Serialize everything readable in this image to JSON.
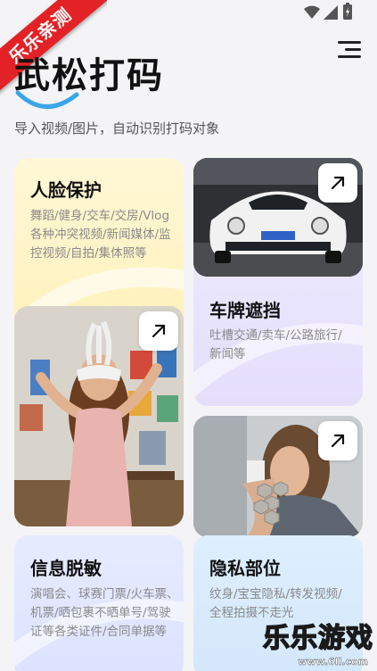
{
  "watermark_top": "乐乐亲测",
  "watermark_bottom": {
    "logo": "乐乐游戏",
    "url": "www.6ll.com"
  },
  "header": {
    "title": "武松打码",
    "subtitle": "导入视频/图片，自动识别打码对象"
  },
  "cards": {
    "face": {
      "title": "人脸保护",
      "desc": [
        "舞蹈/健身/交车/交房/Vlog",
        "各种冲突视频/新闻媒体/监",
        "控视频/自拍/集体照等"
      ]
    },
    "plate": {
      "title": "车牌遮挡",
      "desc": [
        "吐槽交通/卖车/公路旅行/",
        "新闻等"
      ]
    },
    "info": {
      "title": "信息脱敏",
      "desc": [
        "演唱会、球赛门票/火车票、",
        "机票/晒包裹不晒单号/驾驶",
        "证等各类证件/合同单据等"
      ]
    },
    "private": {
      "title": "隐私部位",
      "desc": [
        "纹身/宝宝隐私/转发视频/",
        "全程拍摄不走光"
      ]
    }
  },
  "colors": {
    "accent": "#3aa6e8",
    "ribbon": "#e32227"
  }
}
